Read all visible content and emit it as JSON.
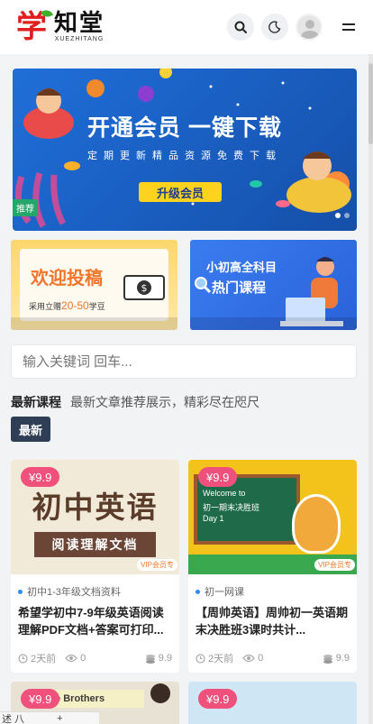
{
  "header": {
    "logo_glyph": "学",
    "logo_name": "知堂",
    "logo_en": "XUEZHITANG",
    "icons": [
      "search-icon",
      "moon-icon",
      "avatar",
      "menu-icon"
    ]
  },
  "banner": {
    "title": "开通会员  一键下载",
    "subtitle": "定期更新精品资源免费下载",
    "cta": "升级会员",
    "tag": "推荐"
  },
  "promos": {
    "left": {
      "title": "欢迎投稿",
      "line_prefix": "采用立赠",
      "line_amount": "20-50",
      "line_suffix": "学豆"
    },
    "right": {
      "line1": "小初高全科目",
      "line2": "热门课程"
    }
  },
  "search": {
    "placeholder": "输入关键词 回车..."
  },
  "section": {
    "title": "最新课程",
    "description": "最新文章推荐展示，精彩尽在咫尺",
    "chip": "最新"
  },
  "cards": [
    {
      "price": "¥9.9",
      "thumb_big": "初中英语",
      "thumb_small": "阅读理解文档",
      "vip": "VIP会员专",
      "category": "初中1-3年级文档资料",
      "title": "希望学初中7-9年级英语阅读理解PDF文档+答案可打印...",
      "time": "2天前",
      "views": "0",
      "points": "9.9"
    },
    {
      "price": "¥9.9",
      "board_l1": "Welcome to",
      "board_l2": "初一期末决胜班",
      "board_l3": "Day 1",
      "vip": "VIP会员专",
      "category": "初一网课",
      "title": "【周帅英语】周帅初一英语期末决胜班3课时共计...",
      "time": "2天前",
      "views": "0",
      "points": "9.9"
    }
  ],
  "cards_next": [
    {
      "price": "¥9.9",
      "strip": "le Brothers"
    },
    {
      "price": "¥9.9"
    }
  ],
  "bottom_tab": {
    "label": "述 八",
    "plus": "+"
  },
  "colors": {
    "accent": "#2d8cf0",
    "price_pill": "#f0507c",
    "chip": "#2f3e55",
    "banner": "#1f6fd8"
  }
}
